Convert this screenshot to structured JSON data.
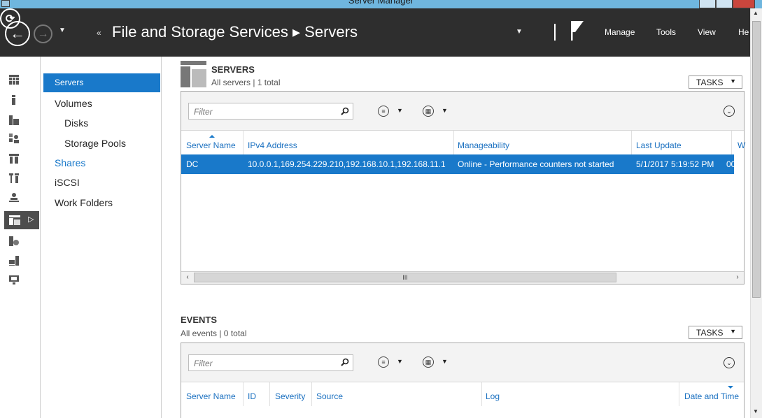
{
  "window": {
    "title": "Server Manager"
  },
  "header": {
    "breadcrumb_arrows": "«",
    "breadcrumb": "File and Storage Services ▸ Servers",
    "menus": [
      "Manage",
      "Tools",
      "View",
      "He"
    ]
  },
  "nav": {
    "items": [
      "Servers",
      "Volumes",
      "Disks",
      "Storage Pools",
      "Shares",
      "iSCSI",
      "Work Folders"
    ]
  },
  "servers": {
    "title": "SERVERS",
    "subtitle": "All servers | 1 total",
    "tasks_label": "TASKS",
    "filter_placeholder": "Filter",
    "columns": [
      "Server Name",
      "IPv4 Address",
      "Manageability",
      "Last Update",
      "W"
    ],
    "rows": [
      {
        "server_name": "DC",
        "ipv4": "10.0.0.1,169.254.229.210,192.168.10.1,192.168.11.1",
        "manageability": "Online - Performance counters not started",
        "last_update": "5/1/2017 5:19:52 PM",
        "w": "00"
      }
    ],
    "scroll_grip": "III"
  },
  "events": {
    "title": "EVENTS",
    "subtitle": "All events | 0 total",
    "tasks_label": "TASKS",
    "filter_placeholder": "Filter",
    "columns": [
      "Server Name",
      "ID",
      "Severity",
      "Source",
      "Log",
      "Date and Time"
    ]
  },
  "colors": {
    "header_bg": "#2e2e2e",
    "accent_blue": "#1979ca",
    "titlebar": "#6fb6de"
  }
}
